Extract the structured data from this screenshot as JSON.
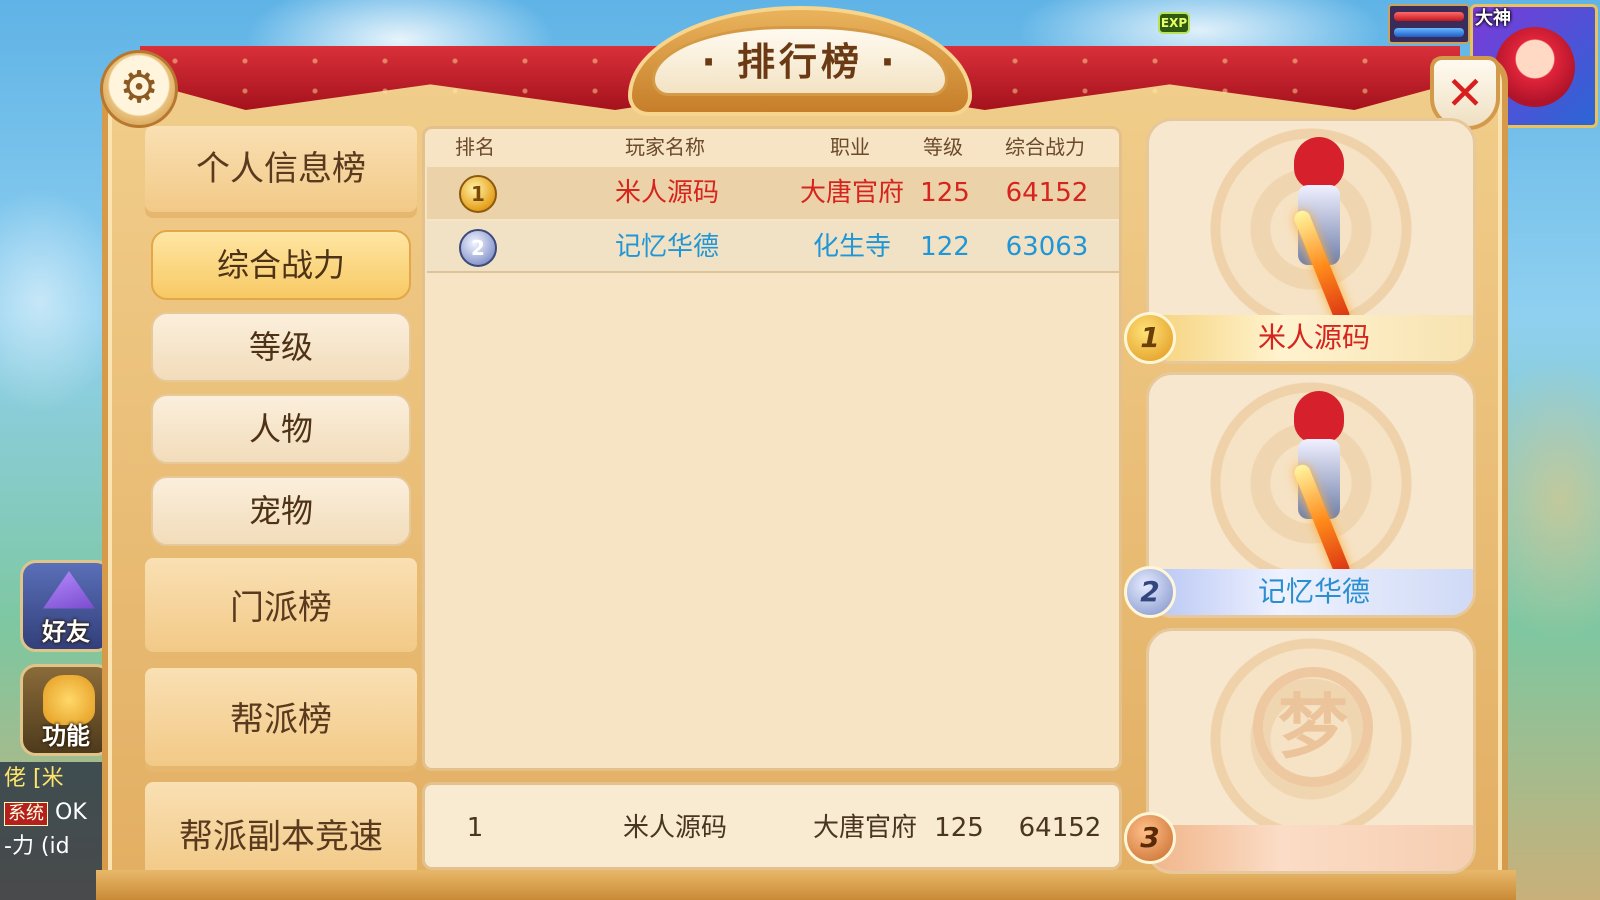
{
  "window": {
    "title": "排行榜"
  },
  "hud": {
    "exp_label": "EXP",
    "player_title": "大神"
  },
  "side_buttons": {
    "friend_label": "好友",
    "function_label": "功能"
  },
  "chat": {
    "line1": "佬 [米",
    "line2_tag": "系统",
    "line2_text": "OK",
    "line3": "-力 (id"
  },
  "tabs": {
    "personal": "个人信息榜",
    "combat_power": "综合战力",
    "level": "等级",
    "character": "人物",
    "pet": "宠物",
    "school": "门派榜",
    "guild": "帮派榜",
    "guild_dungeon": "帮派副本竞速"
  },
  "table": {
    "headers": [
      "排名",
      "玩家名称",
      "职业",
      "等级",
      "综合战力"
    ],
    "rows": [
      {
        "rank": "1",
        "name": "米人源码",
        "job": "大唐官府",
        "level": "125",
        "power": "64152"
      },
      {
        "rank": "2",
        "name": "记忆华德",
        "job": "化生寺",
        "level": "122",
        "power": "63063"
      }
    ]
  },
  "my_rank": {
    "rank": "1",
    "name": "米人源码",
    "job": "大唐官府",
    "level": "125",
    "power": "64152"
  },
  "podium": [
    {
      "place": "1",
      "name": "米人源码"
    },
    {
      "place": "2",
      "name": "记忆华德"
    },
    {
      "place": "3",
      "name": ""
    }
  ],
  "podium_empty_glyph": "梦",
  "colors": {
    "rank1": "#d6241f",
    "rank2": "#2196d6",
    "panel": "#f6e4c4",
    "accent": "#d69b4a"
  }
}
